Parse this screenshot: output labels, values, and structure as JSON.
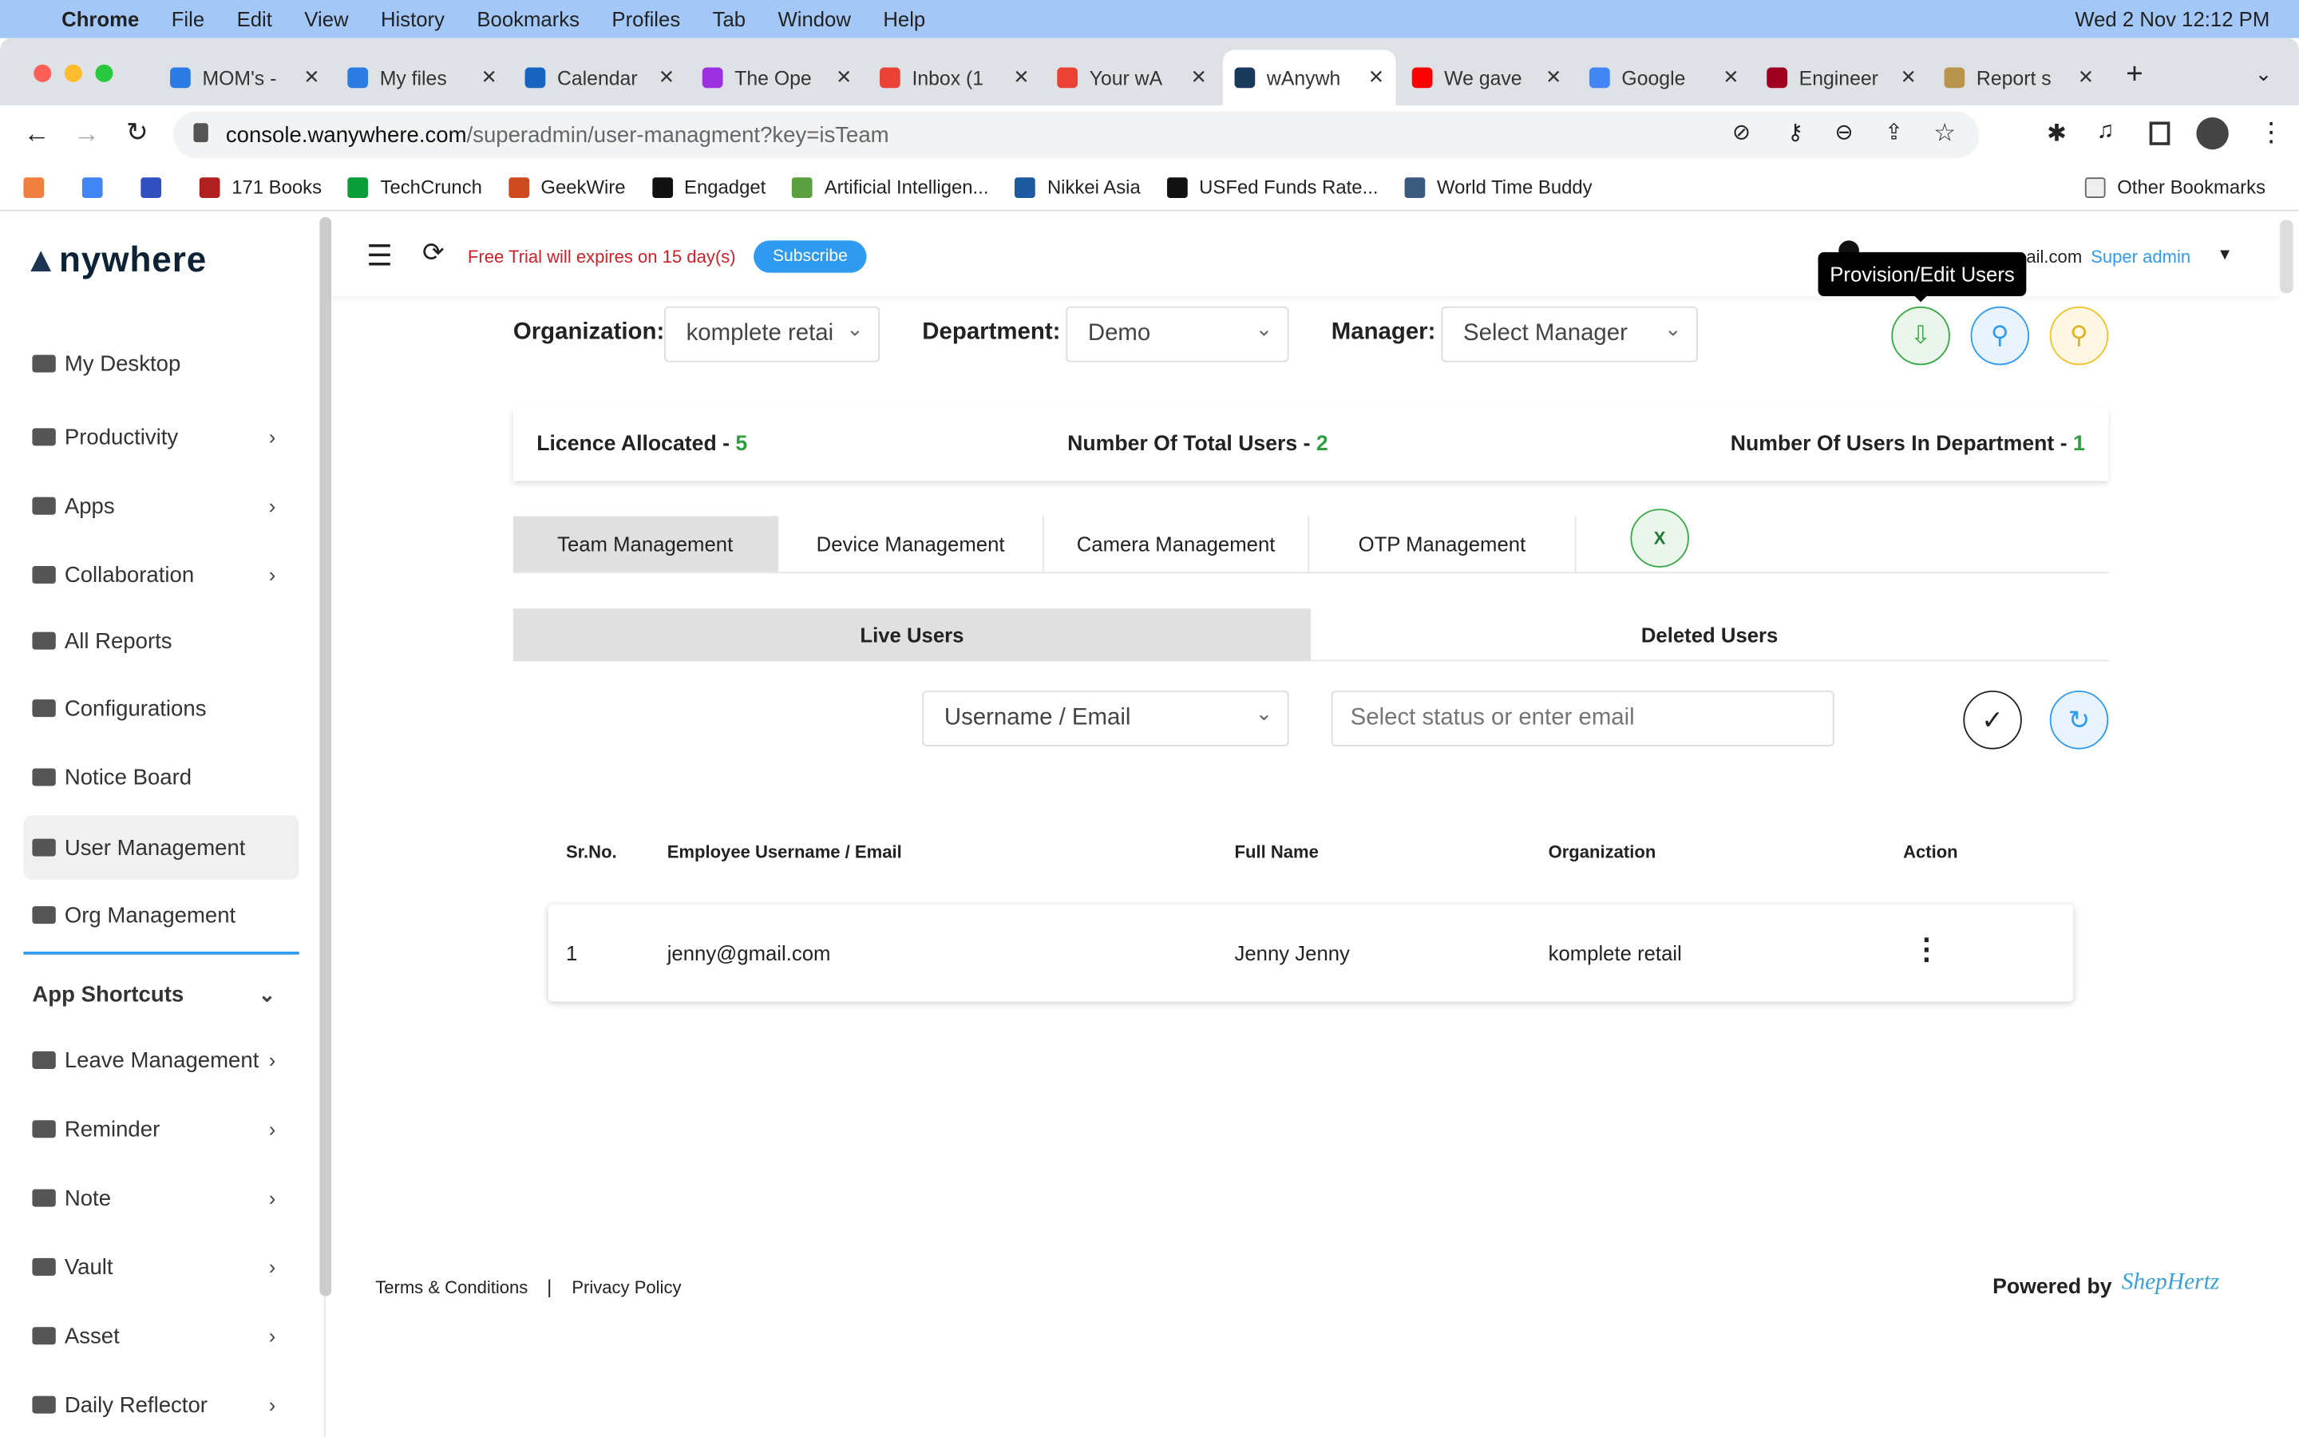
{
  "menubar": {
    "app": "Chrome",
    "items": [
      "File",
      "Edit",
      "View",
      "History",
      "Bookmarks",
      "Profiles",
      "Tab",
      "Window",
      "Help"
    ],
    "clock": "Wed 2 Nov  12:12 PM"
  },
  "tabs": [
    {
      "label": "MOM's -",
      "color": "#2a7be4"
    },
    {
      "label": "My files",
      "color": "#2a7be4"
    },
    {
      "label": "Calendar",
      "color": "#1565c0"
    },
    {
      "label": "The Ope",
      "color": "#9b30e0"
    },
    {
      "label": "Inbox (1",
      "color": "#ea4335"
    },
    {
      "label": "Your wA",
      "color": "#ea4335"
    },
    {
      "label": "wAnywh",
      "color": "#1a3a5c",
      "active": true
    },
    {
      "label": "We gave",
      "color": "#ff0000"
    },
    {
      "label": "Google",
      "color": "#4285f4"
    },
    {
      "label": "Engineer",
      "color": "#a00020"
    },
    {
      "label": "Report s",
      "color": "#b8954a"
    }
  ],
  "address": {
    "host": "console.wanywhere.com",
    "path": "/superadmin/user-managment?key=isTeam"
  },
  "bookmarks": [
    {
      "label": "",
      "color": "#f08040"
    },
    {
      "label": "",
      "color": "#4285f4"
    },
    {
      "label": "",
      "color": "#3050c0"
    },
    {
      "label": "171 Books",
      "color": "#b02020"
    },
    {
      "label": "TechCrunch",
      "color": "#0a9e3a"
    },
    {
      "label": "GeekWire",
      "color": "#d04a20"
    },
    {
      "label": "Engadget",
      "color": "#111"
    },
    {
      "label": "Artificial Intelligen...",
      "color": "#5aa040"
    },
    {
      "label": "Nikkei Asia",
      "color": "#1e5aa0"
    },
    {
      "label": "USFed Funds Rate...",
      "color": "#111"
    },
    {
      "label": "World Time Buddy",
      "color": "#3a5a80"
    }
  ],
  "other_bookmarks": "Other Bookmarks",
  "brand": {
    "logo": "Anywhere"
  },
  "sidebar": {
    "items": [
      {
        "label": "My Desktop"
      },
      {
        "label": "Productivity",
        "chev": true
      },
      {
        "label": "Apps",
        "chev": true
      },
      {
        "label": "Collaboration",
        "chev": true
      },
      {
        "label": "All Reports"
      },
      {
        "label": "Configurations"
      },
      {
        "label": "Notice Board"
      },
      {
        "label": "User Management",
        "active": true
      },
      {
        "label": "Org Management"
      }
    ],
    "shortcuts_title": "App Shortcuts",
    "shortcuts": [
      {
        "label": "Leave Management"
      },
      {
        "label": "Reminder"
      },
      {
        "label": "Note"
      },
      {
        "label": "Vault"
      },
      {
        "label": "Asset"
      },
      {
        "label": "Daily Reflector"
      }
    ]
  },
  "topbar": {
    "trial": "Free Trial will expires on 15 day(s)",
    "subscribe": "Subscribe",
    "email_visible": "ail.com",
    "role": "Super admin",
    "tooltip": "Provision/Edit Users"
  },
  "filters": {
    "org_label": "Organization:",
    "org_value": "komplete retai",
    "dept_label": "Department:",
    "dept_value": "Demo",
    "mgr_label": "Manager:",
    "mgr_value": "Select Manager"
  },
  "stats": {
    "licence_label": "Licence Allocated - ",
    "licence": "5",
    "total_label": "Number Of Total Users - ",
    "total": "2",
    "dept_label": "Number Of Users In Department - ",
    "dept": "1"
  },
  "main_tabs": [
    "Team Management",
    "Device Management",
    "Camera Management",
    "OTP Management"
  ],
  "sub_tabs": [
    "Live Users",
    "Deleted Users"
  ],
  "search": {
    "field": "Username / Email",
    "placeholder": "Select status or enter email"
  },
  "table": {
    "headers": [
      "Sr.No.",
      "Employee Username / Email",
      "Full Name",
      "Organization",
      "Action"
    ],
    "rows": [
      [
        "1",
        "jenny@gmail.com",
        "Jenny Jenny",
        "komplete retail"
      ]
    ]
  },
  "footer": {
    "terms": "Terms & Conditions",
    "sep": "|",
    "privacy": "Privacy Policy",
    "powered": "Powered by",
    "brand": "ShepHertz"
  },
  "colors": {
    "accent": "#2f9bf0",
    "green": "#2e9e3e",
    "trial": "#d0202a"
  }
}
